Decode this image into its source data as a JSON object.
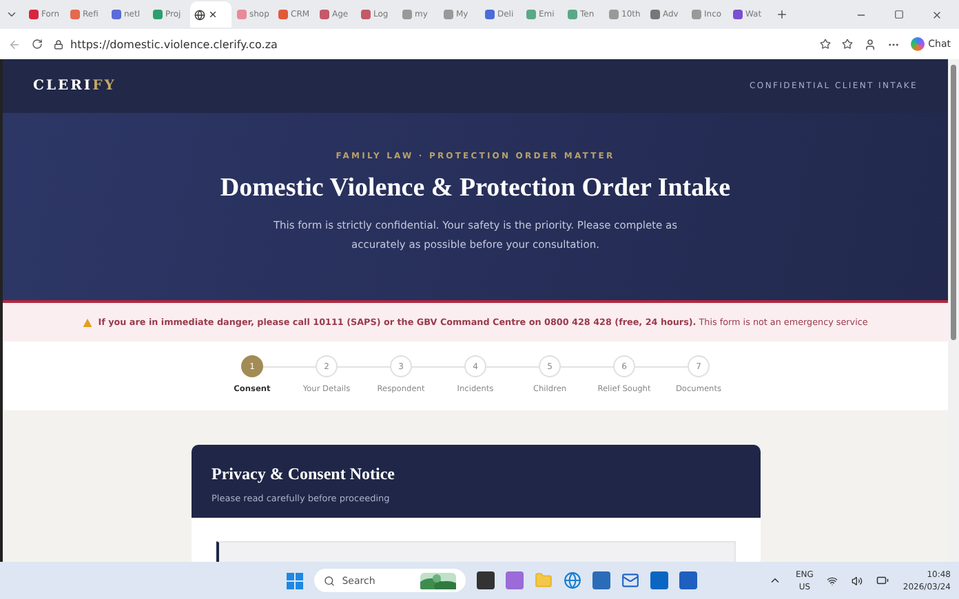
{
  "browser": {
    "tabs": [
      {
        "label": "Forn",
        "selected": false
      },
      {
        "label": "Refi",
        "selected": false
      },
      {
        "label": "netl",
        "selected": false
      },
      {
        "label": "Proj",
        "selected": false
      },
      {
        "selected": true
      },
      {
        "label": "shop",
        "selected": false
      },
      {
        "label": "CRM",
        "selected": false
      },
      {
        "label": "Age",
        "selected": false
      },
      {
        "label": "Log",
        "selected": false
      },
      {
        "label": "my",
        "selected": false
      },
      {
        "label": "My",
        "selected": false
      },
      {
        "label": "Deli",
        "selected": false
      },
      {
        "label": "Emi",
        "selected": false
      },
      {
        "label": "Ten",
        "selected": false
      },
      {
        "label": "10th",
        "selected": false
      },
      {
        "label": "Adv",
        "selected": false
      },
      {
        "label": "Inco",
        "selected": false
      },
      {
        "label": "Wat",
        "selected": false
      }
    ],
    "url": "https://domestic.violence.clerify.co.za",
    "chat_label": "Chat"
  },
  "page": {
    "brand": {
      "main": "CLERI",
      "accent": "FY"
    },
    "header_tag": "CONFIDENTIAL CLIENT INTAKE",
    "hero": {
      "eyebrow": "FAMILY LAW · PROTECTION ORDER MATTER",
      "title": "Domestic Violence & Protection Order Intake",
      "intro": "This form is strictly confidential. Your safety is the priority. Please complete as accurately as possible before your consultation."
    },
    "alert": "**If you are in immediate danger, please call 10111 (SAPS) or the GBV Command Centre on 0800 428 428 (free, 24 hours).** This form is not an emergency service",
    "steps": [
      {
        "number": "1",
        "label": "Consent",
        "selected": true
      },
      {
        "number": "2",
        "label": "Your Details",
        "selected": false
      },
      {
        "number": "3",
        "label": "Respondent",
        "selected": false
      },
      {
        "number": "4",
        "label": "Incidents",
        "selected": false
      },
      {
        "number": "5",
        "label": "Children",
        "selected": false
      },
      {
        "number": "6",
        "label": "Relief Sought",
        "selected": false
      },
      {
        "number": "7",
        "label": "Documents",
        "selected": false
      }
    ],
    "card": {
      "title": "Privacy & Consent Notice",
      "subtitle": "Please read carefully before proceeding"
    }
  },
  "taskbar": {
    "search_placeholder": "Search",
    "language": "ENG",
    "region": "US",
    "time": "10:48",
    "date": "2026/03/24"
  }
}
